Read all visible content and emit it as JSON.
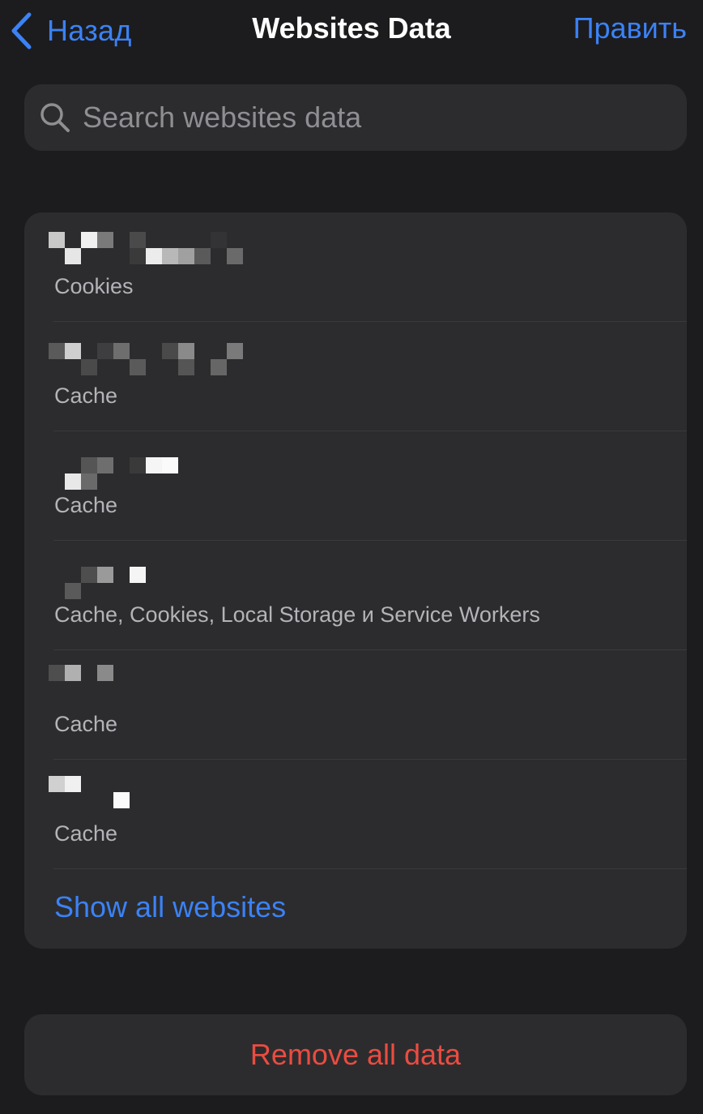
{
  "nav": {
    "back_label": "Назад",
    "title": "Websites Data",
    "edit_label": "Править"
  },
  "search": {
    "placeholder": "Search websites data"
  },
  "sites": [
    {
      "name_obscured": true,
      "kinds": "Cookies"
    },
    {
      "name_obscured": true,
      "kinds": "Cache"
    },
    {
      "name_obscured": true,
      "kinds": "Cache"
    },
    {
      "name_obscured": true,
      "kinds": "Cache, Cookies, Local Storage и Service Workers"
    },
    {
      "name_obscured": true,
      "kinds": "Cache"
    },
    {
      "name_obscured": true,
      "kinds": "Cache"
    }
  ],
  "show_all_label": "Show all websites",
  "remove_all_label": "Remove all data",
  "colors": {
    "accent_blue": "#3b82f6",
    "destructive_red": "#ea4c41",
    "background": "#1c1c1e",
    "card": "#2c2c2e",
    "secondary_text": "#b3b3b8"
  },
  "icons": {
    "back": "chevron-left-icon",
    "search": "magnifying-glass-icon"
  }
}
